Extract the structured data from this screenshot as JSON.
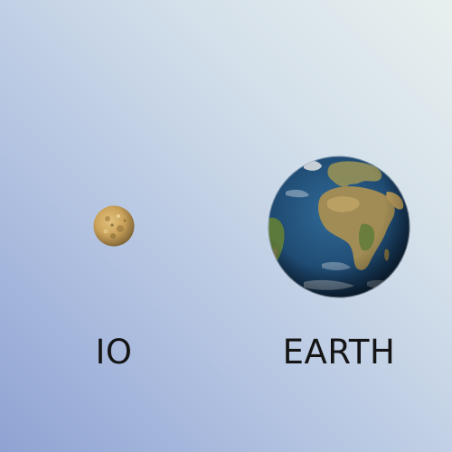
{
  "bodies": [
    {
      "name": "IO",
      "icon": "io-moon-icon",
      "color": "#c9a15a"
    },
    {
      "name": "EARTH",
      "icon": "earth-globe-icon",
      "color": "#1f4a72"
    }
  ],
  "colors": {
    "background_start": "#8fa3d3",
    "background_end": "#e8f0ee",
    "label": "#151515",
    "ocean": "#1f4a72",
    "land": "#9a8a55",
    "io_surface": "#c9a15a"
  }
}
